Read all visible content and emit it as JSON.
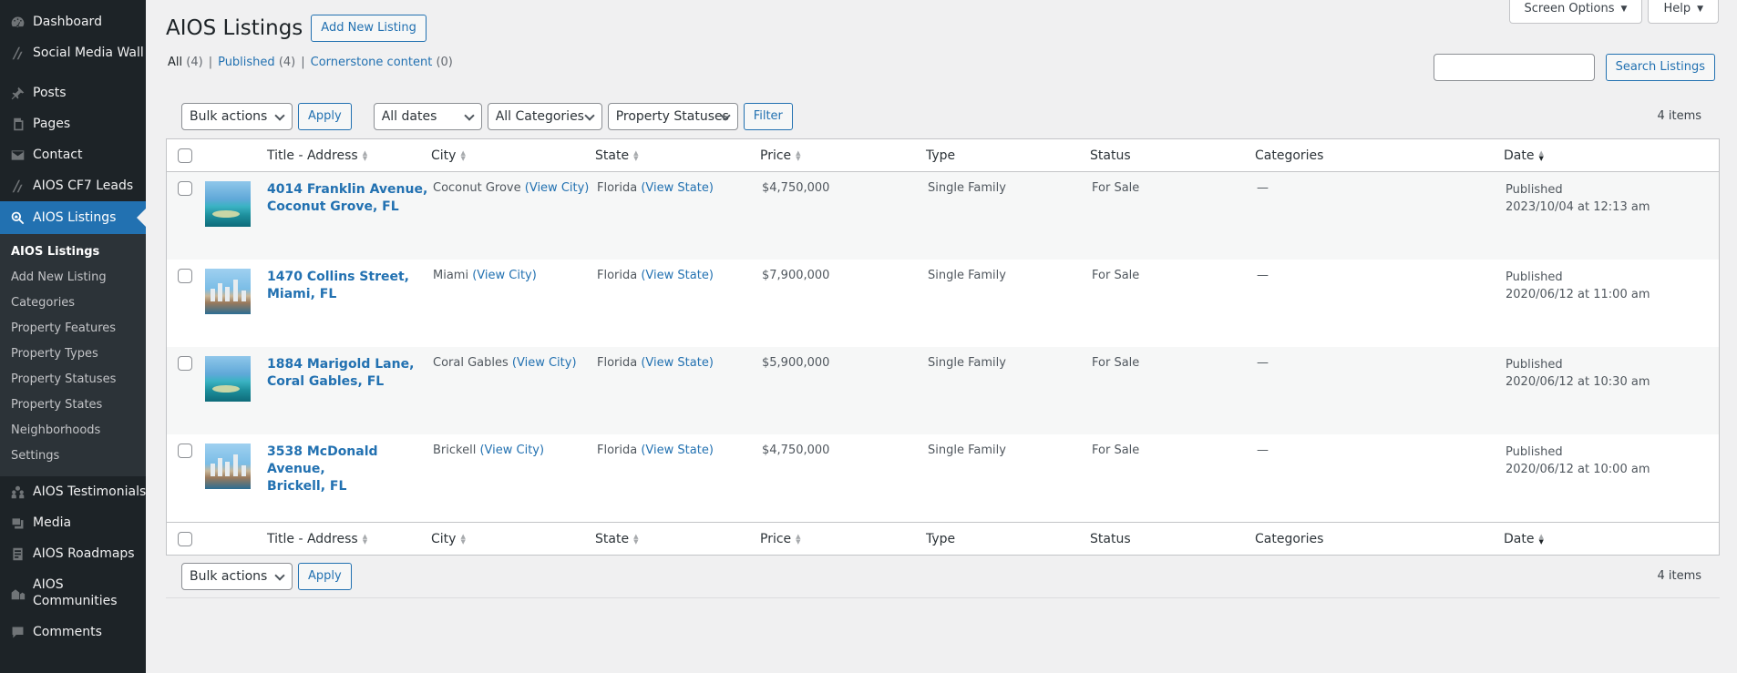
{
  "sidebar": {
    "items_top": [
      {
        "label": "Dashboard",
        "icon": "dashboard-icon"
      },
      {
        "label": "Social Media Wall",
        "icon": "aios-icon"
      }
    ],
    "items_mid": [
      {
        "label": "Posts",
        "icon": "pin-icon"
      },
      {
        "label": "Pages",
        "icon": "pages-icon"
      },
      {
        "label": "Contact",
        "icon": "mail-icon"
      },
      {
        "label": "AIOS CF7 Leads",
        "icon": "aios-icon"
      }
    ],
    "active": {
      "label": "AIOS Listings",
      "icon": "listings-icon"
    },
    "submenu": [
      "AIOS Listings",
      "Add New Listing",
      "Categories",
      "Property Features",
      "Property Types",
      "Property Statuses",
      "Property States",
      "Neighborhoods",
      "Settings"
    ],
    "items_bottom": [
      {
        "label": "AIOS Testimonials",
        "icon": "testimonials-icon"
      },
      {
        "label": "Media",
        "icon": "media-icon"
      },
      {
        "label": "AIOS Roadmaps",
        "icon": "roadmaps-icon"
      },
      {
        "label": "AIOS Communities",
        "icon": "communities-icon"
      },
      {
        "label": "Comments",
        "icon": "comments-icon"
      }
    ]
  },
  "header": {
    "title": "AIOS Listings",
    "add_new": "Add New Listing",
    "screen_options": "Screen Options",
    "help": "Help"
  },
  "views": {
    "all": "All",
    "all_count": "(4)",
    "published": "Published",
    "published_count": "(4)",
    "cornerstone": "Cornerstone content",
    "cornerstone_count": "(0)",
    "sep": "|"
  },
  "search": {
    "button": "Search Listings",
    "value": ""
  },
  "filters": {
    "bulk_actions": "Bulk actions",
    "apply": "Apply",
    "dates": "All dates",
    "categories": "All Categories",
    "statuses": "Property Statuses",
    "filter": "Filter",
    "items_count": "4 items"
  },
  "columns": {
    "title": "Title - Address",
    "city": "City",
    "state": "State",
    "price": "Price",
    "type": "Type",
    "status": "Status",
    "categories": "Categories",
    "date": "Date"
  },
  "rows": [
    {
      "title_line1": "4014 Franklin Avenue,",
      "title_line2": "Coconut Grove, FL",
      "city": "Coconut Grove",
      "state": "Florida",
      "price": "$4,750,000",
      "type": "Single Family",
      "status": "For Sale",
      "categories": "—",
      "date_status": "Published",
      "date": "2023/10/04 at 12:13 am"
    },
    {
      "title_line1": "1470 Collins Street,",
      "title_line2": "Miami, FL",
      "city": "Miami",
      "state": "Florida",
      "price": "$7,900,000",
      "type": "Single Family",
      "status": "For Sale",
      "categories": "—",
      "date_status": "Published",
      "date": "2020/06/12 at 11:00 am"
    },
    {
      "title_line1": "1884 Marigold Lane,",
      "title_line2": "Coral Gables, FL",
      "city": "Coral Gables",
      "state": "Florida",
      "price": "$5,900,000",
      "type": "Single Family",
      "status": "For Sale",
      "categories": "—",
      "date_status": "Published",
      "date": "2020/06/12 at 10:30 am"
    },
    {
      "title_line1": "3538 McDonald Avenue,",
      "title_line2": "Brickell, FL",
      "city": "Brickell",
      "state": "Florida",
      "price": "$4,750,000",
      "type": "Single Family",
      "status": "For Sale",
      "categories": "—",
      "date_status": "Published",
      "date": "2020/06/12 at 10:00 am"
    }
  ],
  "links": {
    "view_city": "(View City)",
    "view_state": "(View State)"
  }
}
